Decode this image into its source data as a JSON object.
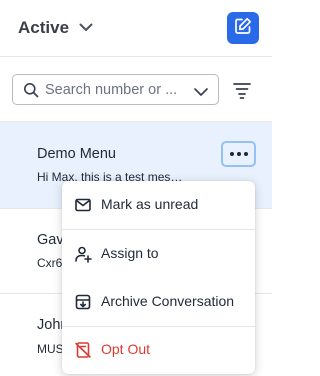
{
  "header": {
    "status_label": "Active",
    "compose_icon": "edit-square-icon"
  },
  "search": {
    "placeholder": "Search number or ...",
    "value": ""
  },
  "conversations": [
    {
      "name": "Demo Menu",
      "preview": "Hi Max, this is a test mes…"
    },
    {
      "name": "Gav",
      "preview": "Cxr6"
    },
    {
      "name": "John",
      "preview": "MUS"
    }
  ],
  "context_menu": {
    "items": [
      {
        "label": "Mark as unread",
        "icon": "envelope-icon"
      },
      {
        "label": "Assign to",
        "icon": "user-plus-icon"
      },
      {
        "label": "Archive Conversation",
        "icon": "archive-icon"
      },
      {
        "label": "Opt Out",
        "icon": "opt-out-icon",
        "color": "#dc3b35"
      }
    ]
  },
  "colors": {
    "accent": "#2a6ae9",
    "selected_row": "#e8f1fd",
    "danger": "#dc3b35"
  }
}
